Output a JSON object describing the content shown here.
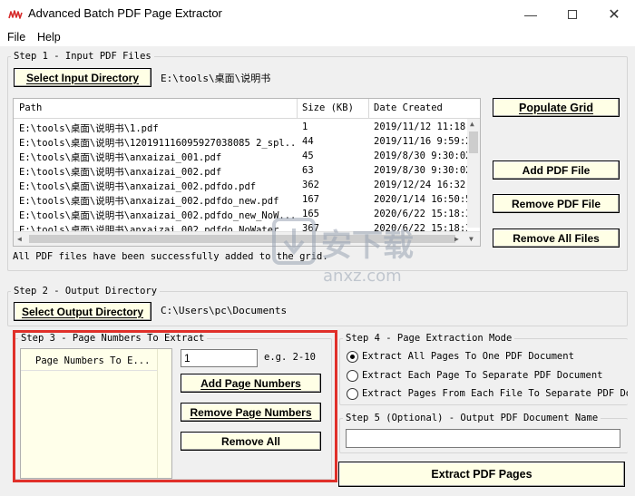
{
  "window": {
    "title": "Advanced Batch PDF Page Extractor",
    "icon": "pdf-scribble-icon",
    "controls": [
      "minimize",
      "maximize",
      "close"
    ]
  },
  "menu": [
    "File",
    "Help"
  ],
  "step1": {
    "legend": "Step 1 - Input PDF Files",
    "select_button": "Select Input Directory",
    "directory": "E:\\tools\\桌面\\说明书",
    "columns": [
      "Path",
      "Size (KB)",
      "Date Created"
    ],
    "rows": [
      {
        "path": "E:\\tools\\桌面\\说明书\\1.pdf",
        "size": "1",
        "date": "2019/11/12 11:18:"
      },
      {
        "path": "E:\\tools\\桌面\\说明书\\120191116095927038085 2_spl...",
        "size": "44",
        "date": "2019/11/16 9:59:2"
      },
      {
        "path": "E:\\tools\\桌面\\说明书\\anxaizai_001.pdf",
        "size": "45",
        "date": "2019/8/30 9:30:02"
      },
      {
        "path": "E:\\tools\\桌面\\说明书\\anxaizai_002.pdf",
        "size": "63",
        "date": "2019/8/30 9:30:02"
      },
      {
        "path": "E:\\tools\\桌面\\说明书\\anxaizai_002.pdfdo.pdf",
        "size": "362",
        "date": "2019/12/24 16:32:"
      },
      {
        "path": "E:\\tools\\桌面\\说明书\\anxaizai_002.pdfdo_new.pdf",
        "size": "167",
        "date": "2020/1/14 16:50:5"
      },
      {
        "path": "E:\\tools\\桌面\\说明书\\anxaizai_002.pdfdo_new_NoW...",
        "size": "165",
        "date": "2020/6/22 15:18:3"
      },
      {
        "path": "E:\\tools\\桌面\\说明书\\anxaizai_002.pdfdo_NoWater...",
        "size": "367",
        "date": "2020/6/22 15:18:3"
      }
    ],
    "status": "All PDF files have been successfully added to the grid.",
    "buttons": {
      "populate": "Populate Grid",
      "add": "Add PDF File",
      "remove": "Remove PDF File",
      "remove_all": "Remove All Files"
    }
  },
  "step2": {
    "legend": "Step 2 - Output Directory",
    "select_button": "Select Output Directory",
    "directory": "C:\\Users\\pc\\Documents"
  },
  "step3": {
    "legend": "Step 3 - Page Numbers To Extract",
    "list_header": "Page Numbers To E...",
    "input_value": "1",
    "hint": "e.g. 2-10",
    "buttons": {
      "add": "Add Page Numbers",
      "remove": "Remove Page Numbers",
      "remove_all": "Remove All"
    }
  },
  "step4": {
    "legend": "Step 4 - Page Extraction Mode",
    "options": [
      {
        "label": "Extract All Pages To One PDF Document",
        "selected": true
      },
      {
        "label": "Extract Each Page To Separate PDF Document",
        "selected": false
      },
      {
        "label": "Extract Pages From Each File To Separate PDF Docu",
        "selected": false
      }
    ]
  },
  "step5": {
    "legend": "Step 5 (Optional) - Output PDF Document Name",
    "value": ""
  },
  "extract_button": "Extract PDF Pages",
  "watermark": {
    "text": "安下载",
    "subtext": "anxz.com"
  },
  "colors": {
    "highlight": "#e0302a",
    "button_bg": "#ffffe6",
    "window_bg": "#f0f0f0"
  }
}
